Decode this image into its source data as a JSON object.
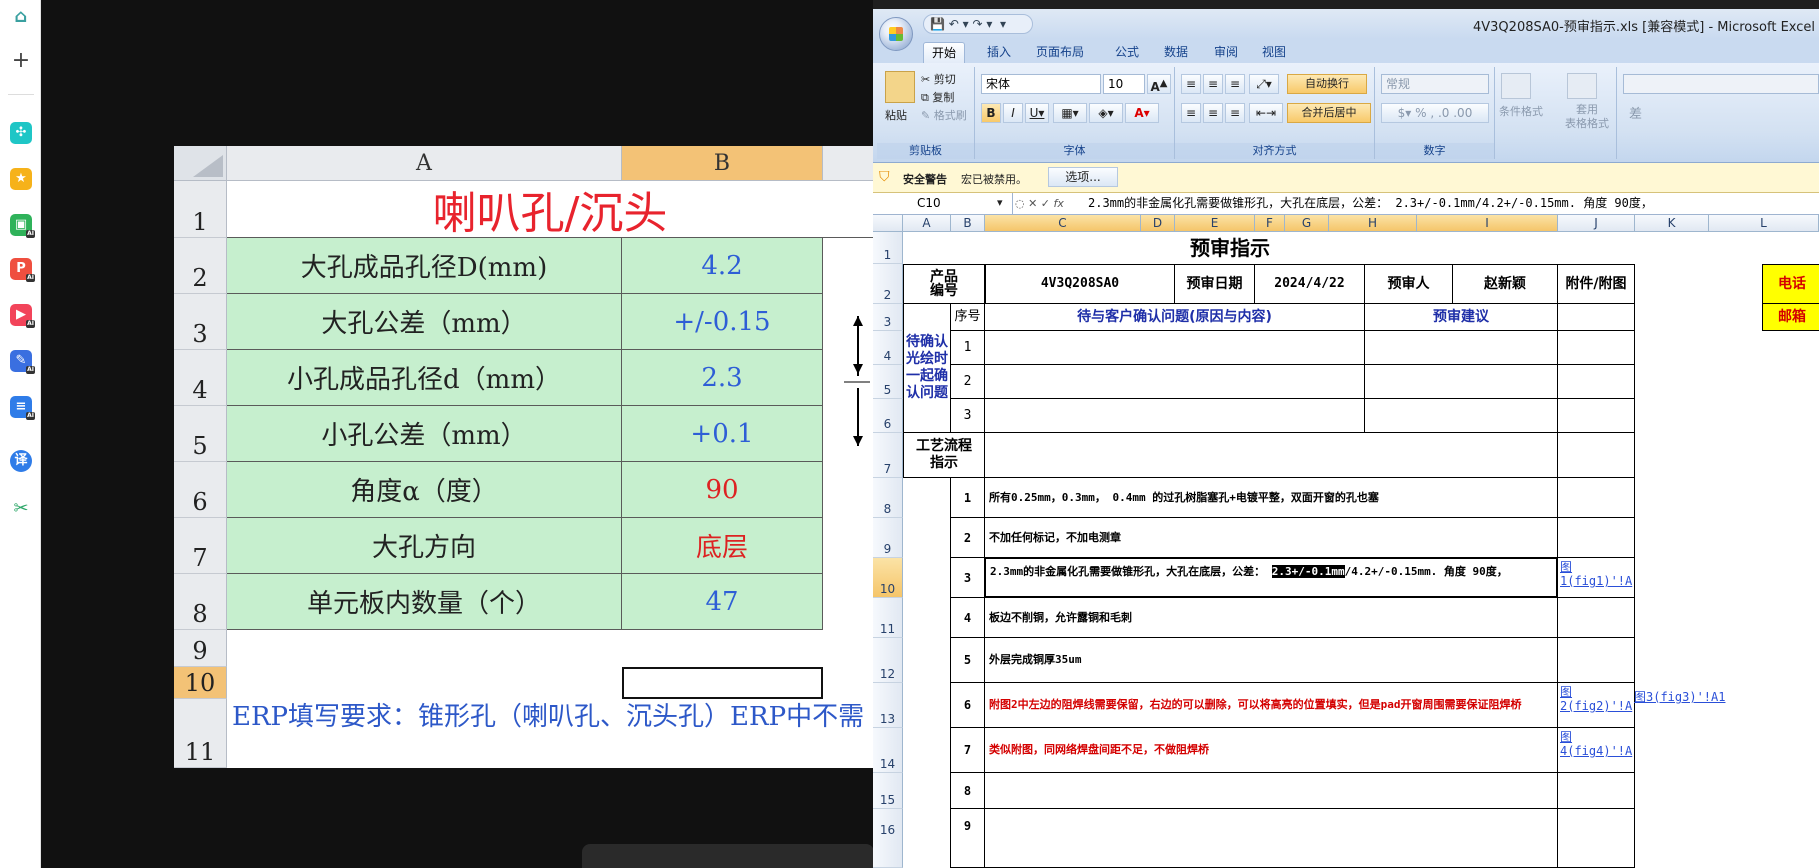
{
  "sidebar": {
    "icons": [
      "home-icon",
      "add-icon",
      "network-icon",
      "star-icon",
      "image-ai-icon",
      "pdf-ai-icon",
      "video-ai-icon",
      "edit-ai-icon",
      "doc-ai-icon",
      "translate-icon",
      "scissors-icon"
    ],
    "ai_badge": "AI",
    "translate_glyph": "译"
  },
  "left_sheet": {
    "col_a": "A",
    "col_b": "B",
    "rows": [
      "1",
      "2",
      "3",
      "4",
      "5",
      "6",
      "7",
      "8",
      "9",
      "10",
      "11"
    ],
    "title": "喇叭孔/沉头",
    "items": [
      {
        "label": "大孔成品孔径D(mm)",
        "value": "4.2"
      },
      {
        "label": "大孔公差（mm）",
        "value": "+/-0.15"
      },
      {
        "label": "小孔成品孔径d（mm）",
        "value": "2.3"
      },
      {
        "label": "小孔公差（mm）",
        "value": "+0.1"
      },
      {
        "label": "角度α（度）",
        "value": "90"
      },
      {
        "label": "大孔方向",
        "value": "底层"
      },
      {
        "label": "单元板内数量（个）",
        "value": "47"
      }
    ],
    "erp_note": "ERP填写要求：锥形孔（喇叭孔、沉头孔）ERP中不需"
  },
  "excel": {
    "window_title": "4V3Q208SA0-预审指示.xls  [兼容模式] - Microsoft Excel",
    "tabs": [
      "开始",
      "插入",
      "页面布局",
      "公式",
      "数据",
      "审阅",
      "视图"
    ],
    "clipboard": {
      "paste": "粘贴",
      "cut": "剪切",
      "copy": "复制",
      "format_painter": "格式刷",
      "group": "剪贴板"
    },
    "font": {
      "name": "宋体",
      "size": "10",
      "group": "字体"
    },
    "alignment": {
      "wrap": "自动换行",
      "merge": "合并后居中",
      "group": "对齐方式"
    },
    "number": {
      "format": "常规",
      "group": "数字"
    },
    "styles": {
      "conditional": "条件格式",
      "table": "套用\n表格格式",
      "bad": "差"
    },
    "security": {
      "label": "安全警告",
      "message": "宏已被禁用。",
      "options": "选项..."
    },
    "name_box": "C10",
    "formula": "2.3mm的非金属化孔需要做锥形孔，大孔在底层，公差： 2.3+/-0.1mm/4.2+/-0.15mm. 角度 90度，",
    "columns": [
      "A",
      "B",
      "C",
      "D",
      "E",
      "F",
      "G",
      "H",
      "I",
      "J",
      "K",
      "L"
    ],
    "rows": [
      "1",
      "2",
      "3",
      "4",
      "5",
      "6",
      "7",
      "8",
      "9",
      "10",
      "11",
      "12",
      "13",
      "14",
      "15",
      "16"
    ],
    "sheet_title": "预审指示",
    "product_no_label": "产品\n编号",
    "product_no": "4V3Q208SA0",
    "date_label": "预审日期",
    "date": "2024/4/22",
    "reviewer_label": "预审人",
    "reviewer": "赵新颖",
    "attachment_label": "附件/附图",
    "phone_label": "电话",
    "email_label": "邮箱",
    "seq_label": "序号",
    "confirm_header": "待与客户确认问题(原因与内容)",
    "suggest_header": "预审建议",
    "pending_label": "待确认\n光绘时\n一起确\n认问题",
    "pending_nums": [
      "1",
      "2",
      "3"
    ],
    "process_label": "工艺流程\n指示",
    "steps": [
      {
        "no": "1",
        "text": "所有0.25mm，0.3mm， 0.4mm 的过孔树脂塞孔+电镀平整，双面开窗的孔也塞",
        "red": false,
        "link": ""
      },
      {
        "no": "2",
        "text": "不加任何标记，不加电测章",
        "red": false,
        "link": ""
      },
      {
        "no": "3",
        "text_a": "2.3mm的非金属化孔需要做锥形孔，大孔在底层，公差： ",
        "text_sel": "2.3+/-0.1mm",
        "text_b": "/4.2+/-0.15mm. 角度 90度，",
        "red": false,
        "link": "图\n1(fig1)'!A"
      },
      {
        "no": "4",
        "text": "板边不削铜，允许露铜和毛刺",
        "red": false,
        "link": ""
      },
      {
        "no": "5",
        "text": "外层完成铜厚35um",
        "red": false,
        "link": ""
      },
      {
        "no": "6",
        "text": "附图2中左边的阻焊线需要保留，右边的可以删除，可以将高亮的位置填实，但是pad开窗周围需要保证阻焊桥",
        "red": true,
        "link": "图\n2(fig2)'!A",
        "link2": "图3(fig3)'!A1"
      },
      {
        "no": "7",
        "text": "类似附图，同网络焊盘间距不足，不做阻焊桥",
        "red": true,
        "link": "图\n4(fig4)'!A"
      },
      {
        "no": "8",
        "text": "",
        "red": false,
        "link": ""
      },
      {
        "no": "9",
        "text": "",
        "red": false,
        "link": ""
      }
    ]
  }
}
